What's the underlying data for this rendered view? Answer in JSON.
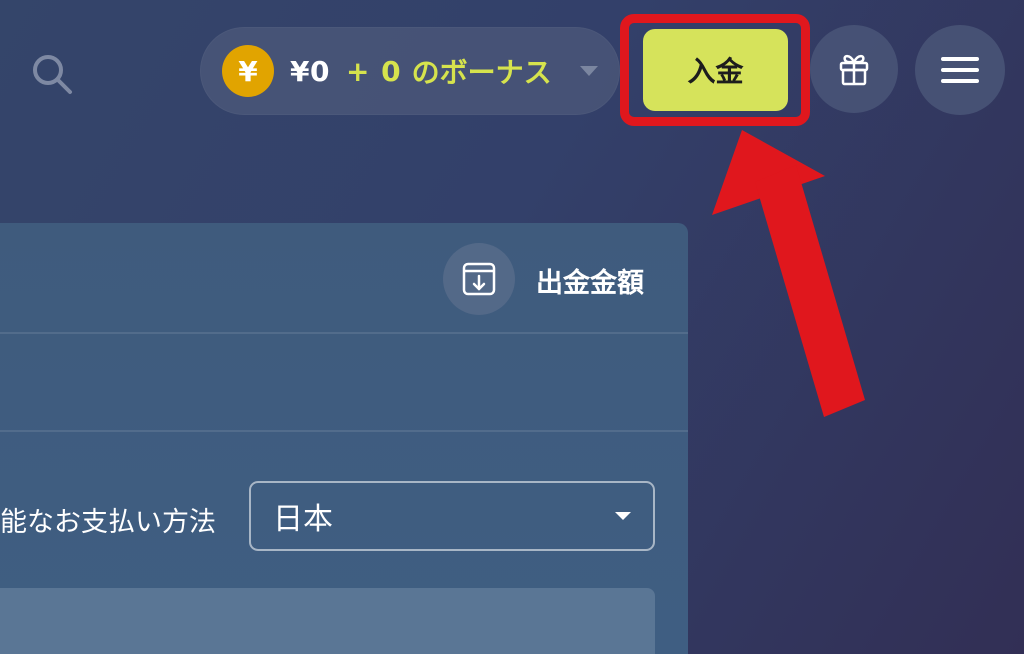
{
  "header": {
    "search_icon": "search-icon",
    "balance": {
      "currency_symbol": "¥",
      "amount": "¥0",
      "bonus_amount": "+ 0",
      "bonus_label": "のボーナス"
    },
    "deposit_label": "入金",
    "gift_icon": "gift-icon",
    "menu_icon": "menu-icon"
  },
  "panel": {
    "withdraw_label": "出金金額",
    "withdraw_icon": "withdraw-icon",
    "payment_methods_label": "能なお支払い方法",
    "country_select_value": "日本"
  },
  "colors": {
    "background": "#34456a",
    "panel": "#3f5b7d",
    "accent_yellow_green": "#d6e35b",
    "bonus_text": "#d6e34d",
    "coin": "#e1a400",
    "highlight_red": "#e0171d"
  }
}
